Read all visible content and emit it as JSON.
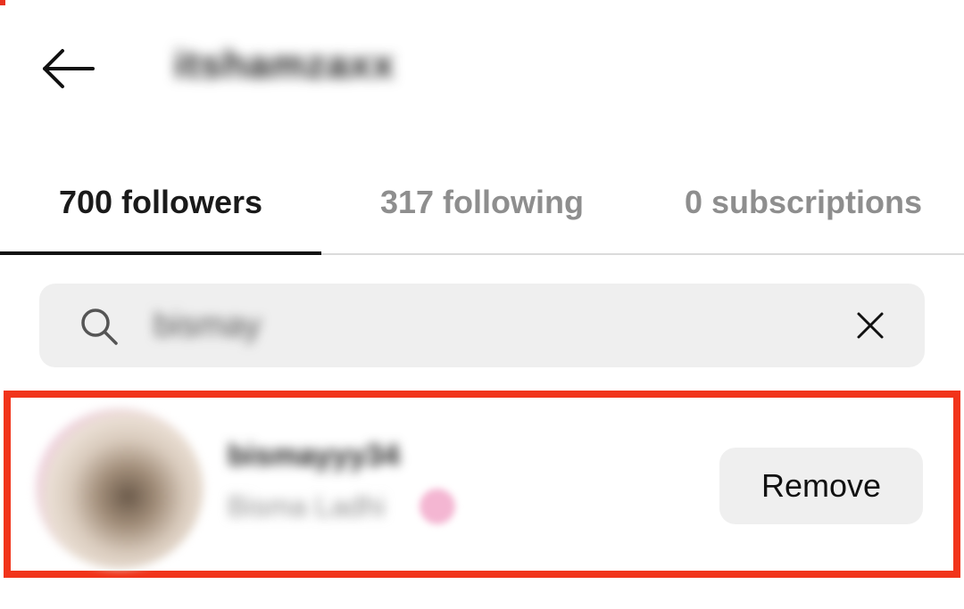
{
  "header": {
    "back_icon": "arrow-left-icon",
    "username": "itshamzaxx"
  },
  "tabs": [
    {
      "label": "700 followers",
      "active": true
    },
    {
      "label": "317 following",
      "active": false
    },
    {
      "label": "0 subscriptions",
      "active": false
    }
  ],
  "search": {
    "icon": "search-icon",
    "value": "bismay",
    "clear_icon": "close-icon"
  },
  "followers": [
    {
      "username": "bismayyy34",
      "full_name": "Bisma Ladhi",
      "action_label": "Remove"
    }
  ],
  "colors": {
    "highlight": "#f1341a",
    "active_text": "#1a1a1a",
    "inactive_text": "#8e8e8e",
    "field_bg": "#efefef"
  }
}
